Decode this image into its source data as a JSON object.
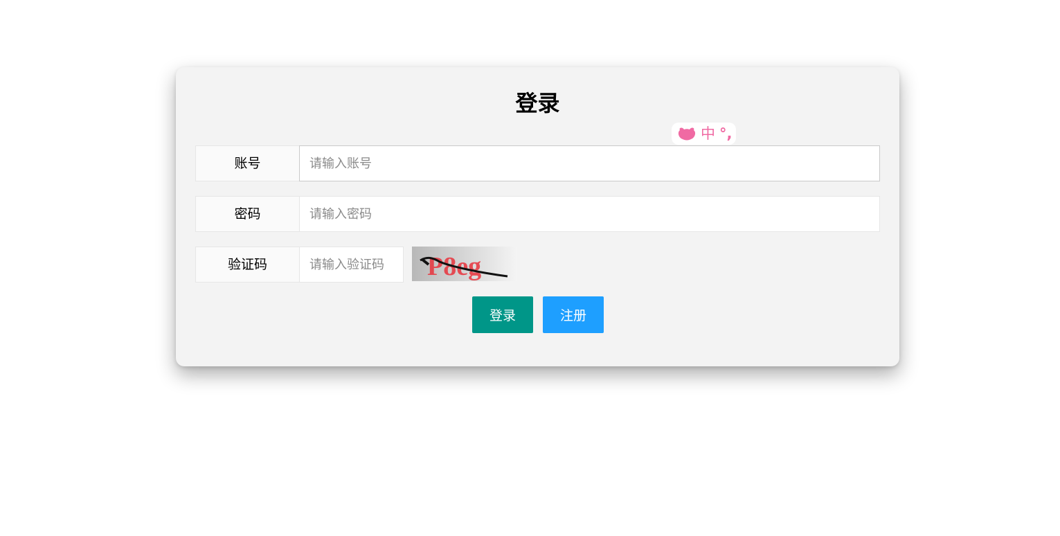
{
  "form": {
    "title": "登录",
    "account": {
      "label": "账号",
      "placeholder": "请输入账号",
      "value": ""
    },
    "password": {
      "label": "密码",
      "placeholder": "请输入密码",
      "value": ""
    },
    "captcha": {
      "label": "验证码",
      "placeholder": "请输入验证码",
      "value": "",
      "image_text": "P8eg"
    },
    "login_button": "登录",
    "register_button": "注册"
  },
  "ime_indicator": {
    "icon": "paw-icon",
    "language": "中",
    "punctuation": "°,"
  },
  "colors": {
    "background": "#ffffff",
    "card": "#f3f3f3",
    "login_button": "#009688",
    "register_button": "#1e9fff",
    "ime_accent": "#f06aa3"
  }
}
